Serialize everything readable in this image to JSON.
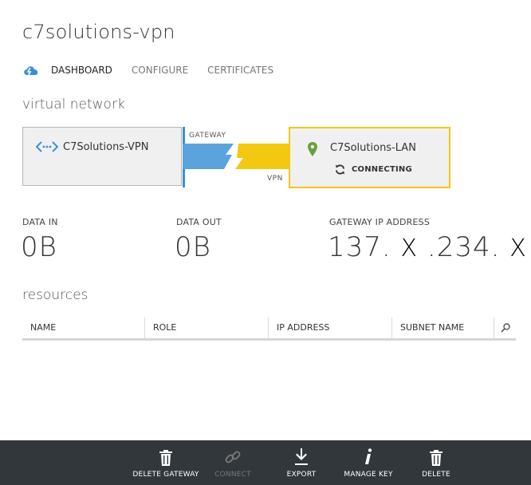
{
  "page": {
    "title": "c7solutions-vpn"
  },
  "tabs": [
    {
      "label": "DASHBOARD",
      "active": true
    },
    {
      "label": "CONFIGURE",
      "active": false
    },
    {
      "label": "CERTIFICATES",
      "active": false
    }
  ],
  "virtual_network": {
    "heading": "virtual network",
    "vnet_name": "C7Solutions-VPN",
    "gateway_label": "GATEWAY",
    "vpn_label": "VPN",
    "local_network_name": "C7Solutions-LAN",
    "connection_status": "CONNECTING"
  },
  "stats": {
    "data_in_label": "DATA IN",
    "data_in_value": "0B",
    "data_out_label": "DATA OUT",
    "data_out_value": "0B",
    "gateway_ip_label": "GATEWAY IP ADDRESS",
    "gateway_ip_part1": "137.",
    "gateway_ip_x1": "X",
    "gateway_ip_part2": ".234.",
    "gateway_ip_x2": "X"
  },
  "resources": {
    "heading": "resources",
    "columns": [
      "NAME",
      "ROLE",
      "IP ADDRESS",
      "SUBNET NAME"
    ]
  },
  "footer_actions": [
    {
      "label": "DELETE GATEWAY",
      "icon": "trash-icon",
      "enabled": true
    },
    {
      "label": "CONNECT",
      "icon": "link-icon",
      "enabled": false
    },
    {
      "label": "EXPORT",
      "icon": "download-icon",
      "enabled": true
    },
    {
      "label": "MANAGE KEY",
      "icon": "info-icon",
      "enabled": true
    },
    {
      "label": "DELETE",
      "icon": "trash-icon",
      "enabled": true
    }
  ],
  "colors": {
    "gateway_blue": "#3a8fd6",
    "vpn_yellow": "#f2c811",
    "footer_bg": "#32373c"
  }
}
